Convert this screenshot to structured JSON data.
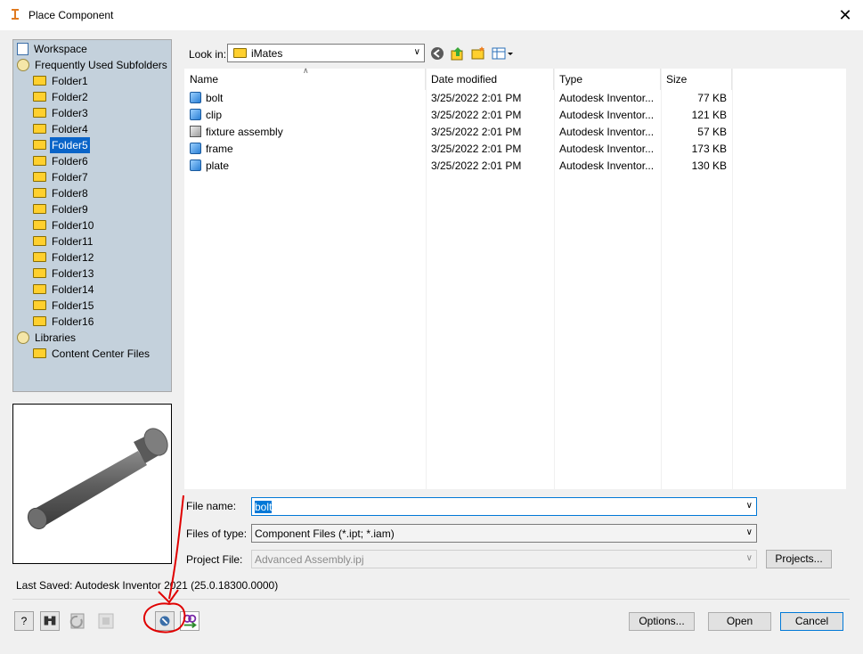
{
  "window": {
    "title": "Place Component",
    "close_glyph": "✕"
  },
  "places": {
    "items": [
      {
        "label": "Workspace",
        "icon": "workspace-icon",
        "indent": 0
      },
      {
        "label": "Frequently Used Subfolders",
        "icon": "favorites-icon",
        "indent": 0
      },
      {
        "label": "Folder1",
        "icon": "folder-icon",
        "indent": 1
      },
      {
        "label": "Folder2",
        "icon": "folder-icon",
        "indent": 1
      },
      {
        "label": "Folder3",
        "icon": "folder-icon",
        "indent": 1
      },
      {
        "label": "Folder4",
        "icon": "folder-icon",
        "indent": 1
      },
      {
        "label": "Folder5",
        "icon": "folder-icon",
        "indent": 1,
        "selected": true
      },
      {
        "label": "Folder6",
        "icon": "folder-icon",
        "indent": 1
      },
      {
        "label": "Folder7",
        "icon": "folder-icon",
        "indent": 1
      },
      {
        "label": "Folder8",
        "icon": "folder-icon",
        "indent": 1
      },
      {
        "label": "Folder9",
        "icon": "folder-icon",
        "indent": 1
      },
      {
        "label": "Folder10",
        "icon": "folder-icon",
        "indent": 1
      },
      {
        "label": "Folder11",
        "icon": "folder-icon",
        "indent": 1
      },
      {
        "label": "Folder12",
        "icon": "folder-icon",
        "indent": 1
      },
      {
        "label": "Folder13",
        "icon": "folder-icon",
        "indent": 1
      },
      {
        "label": "Folder14",
        "icon": "folder-icon",
        "indent": 1
      },
      {
        "label": "Folder15",
        "icon": "folder-icon",
        "indent": 1
      },
      {
        "label": "Folder16",
        "icon": "folder-icon",
        "indent": 1
      },
      {
        "label": "Libraries",
        "icon": "favorites-icon",
        "indent": 0
      },
      {
        "label": "Content Center Files",
        "icon": "folder-icon",
        "indent": 1
      }
    ]
  },
  "lookin": {
    "label": "Look in:",
    "value": "iMates"
  },
  "columns": {
    "name": "Name",
    "date": "Date modified",
    "type": "Type",
    "size": "Size"
  },
  "files": [
    {
      "name": "bolt",
      "date": "3/25/2022 2:01 PM",
      "type": "Autodesk Inventor...",
      "size": "77 KB",
      "kind": "part"
    },
    {
      "name": "clip",
      "date": "3/25/2022 2:01 PM",
      "type": "Autodesk Inventor...",
      "size": "121 KB",
      "kind": "part"
    },
    {
      "name": "fixture assembly",
      "date": "3/25/2022 2:01 PM",
      "type": "Autodesk Inventor...",
      "size": "57 KB",
      "kind": "assembly"
    },
    {
      "name": "frame",
      "date": "3/25/2022 2:01 PM",
      "type": "Autodesk Inventor...",
      "size": "173 KB",
      "kind": "part"
    },
    {
      "name": "plate",
      "date": "3/25/2022 2:01 PM",
      "type": "Autodesk Inventor...",
      "size": "130 KB",
      "kind": "part"
    }
  ],
  "form": {
    "file_name_label": "File name:",
    "file_name_value": "bolt",
    "files_of_type_label": "Files of type:",
    "files_of_type_value": "Component Files (*.ipt; *.iam)",
    "project_file_label": "Project File:",
    "project_file_value": "Advanced Assembly.ipj",
    "projects_button": "Projects..."
  },
  "last_saved": "Last Saved: Autodesk Inventor 2021 (25.0.18300.0000)",
  "buttons": {
    "options": "Options...",
    "open": "Open",
    "cancel": "Cancel"
  },
  "colors": {
    "selection": "#0a64c8",
    "places_bg": "#c4d1dc",
    "annotation": "#e00000"
  }
}
